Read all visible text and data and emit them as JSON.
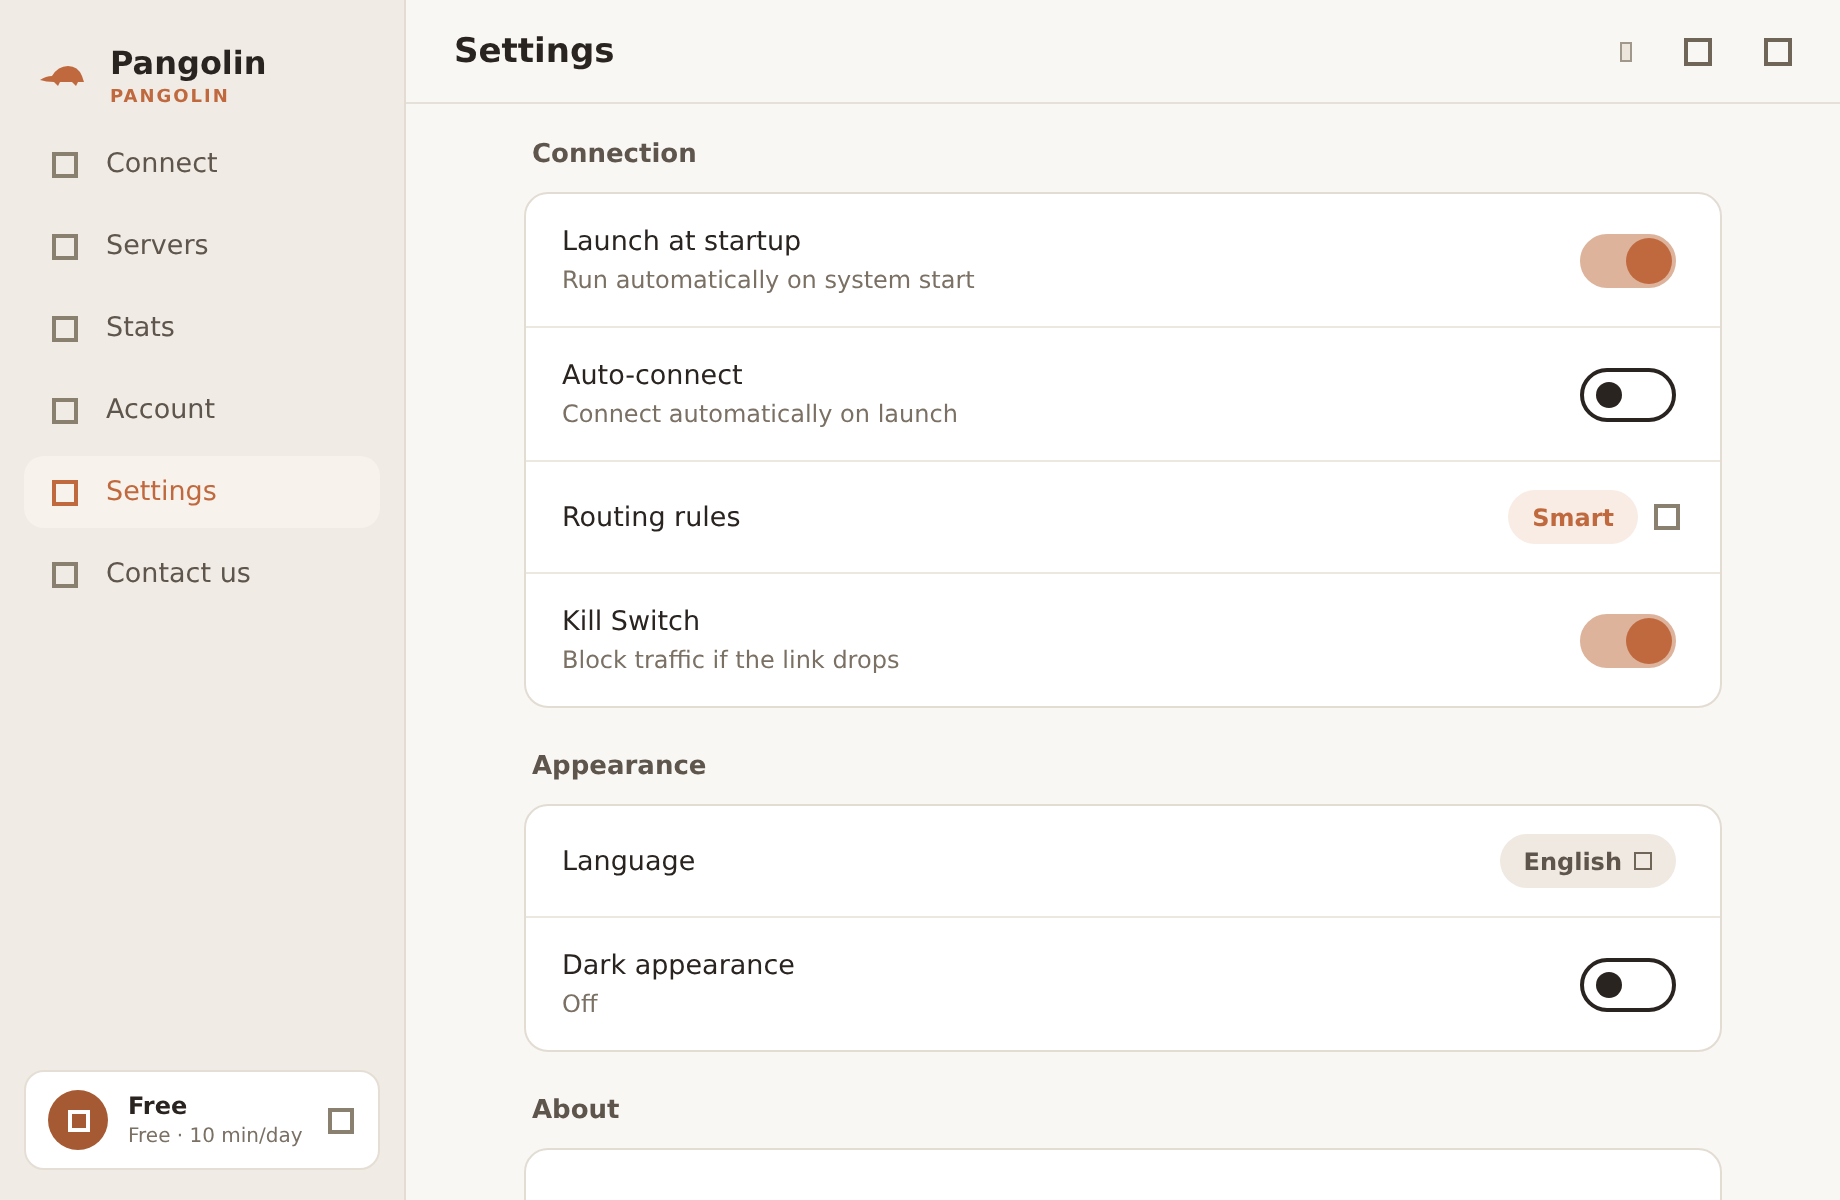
{
  "app": {
    "name": "Pangolin",
    "subtitle": "PANGOLIN"
  },
  "sidebar": {
    "items": [
      {
        "label": "Connect",
        "selected": false
      },
      {
        "label": "Servers",
        "selected": false
      },
      {
        "label": "Stats",
        "selected": false
      },
      {
        "label": "Account",
        "selected": false
      },
      {
        "label": "Settings",
        "selected": true
      },
      {
        "label": "Contact us",
        "selected": false
      }
    ]
  },
  "plan_card": {
    "title": "Free",
    "detail": "Free · 10 min/day"
  },
  "header": {
    "title": "Settings"
  },
  "sections": [
    {
      "title": "Connection",
      "rows": [
        {
          "kind": "toggle",
          "label": "Launch at startup",
          "description": "Run automatically on system start",
          "on": true
        },
        {
          "kind": "toggle",
          "label": "Auto-connect",
          "description": "Connect automatically on launch",
          "on": false
        },
        {
          "kind": "badge",
          "label": "Routing rules",
          "value": "Smart"
        },
        {
          "kind": "toggle",
          "label": "Kill Switch",
          "description": "Block traffic if the link drops",
          "on": true
        }
      ]
    },
    {
      "title": "Appearance",
      "rows": [
        {
          "kind": "dropdown",
          "label": "Language",
          "value": "English"
        },
        {
          "kind": "toggle",
          "label": "Dark appearance",
          "description": "Off",
          "on": false
        }
      ]
    },
    {
      "title": "About"
    }
  ]
}
